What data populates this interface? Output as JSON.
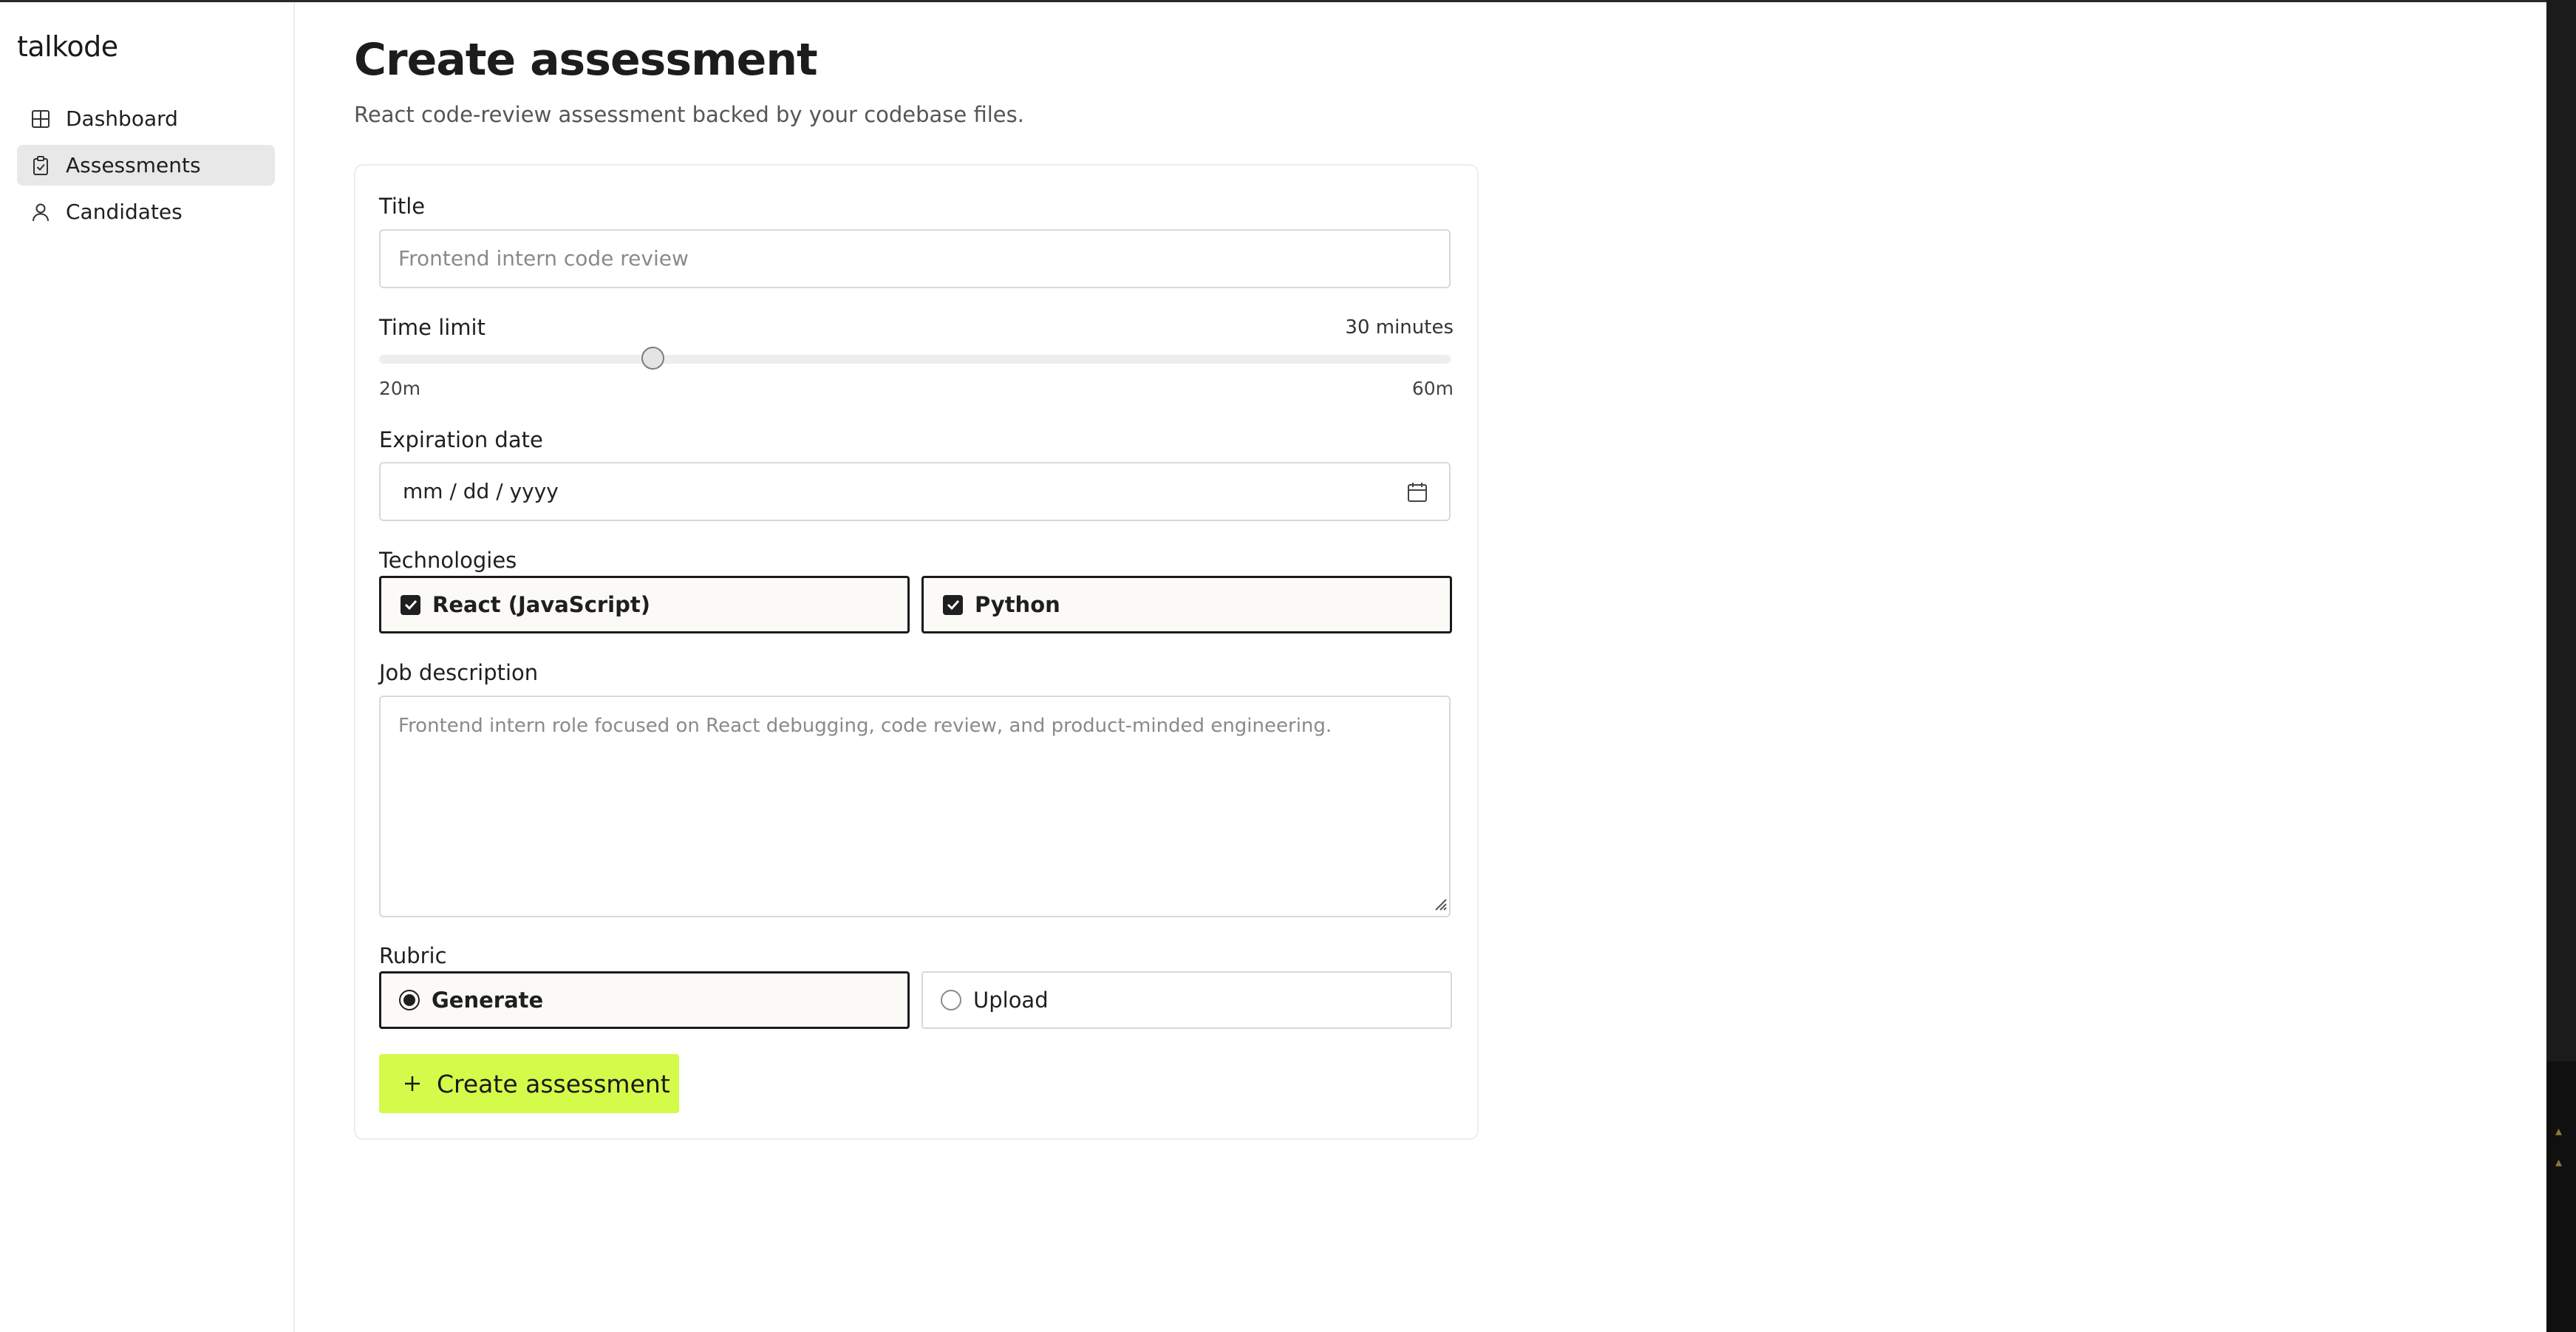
{
  "app": {
    "brand": "talkode"
  },
  "sidebar": {
    "items": [
      {
        "label": "Dashboard",
        "icon": "grid-icon",
        "active": false
      },
      {
        "label": "Assessments",
        "icon": "clipboard-check-icon",
        "active": true
      },
      {
        "label": "Candidates",
        "icon": "user-icon",
        "active": false
      }
    ]
  },
  "page": {
    "title": "Create assessment",
    "subtitle": "React code-review assessment backed by your codebase files."
  },
  "form": {
    "title_label": "Title",
    "title_placeholder": "Frontend intern code review",
    "time_limit": {
      "label": "Time limit",
      "value_text": "30 minutes",
      "min_label": "20m",
      "max_label": "60m",
      "min": 20,
      "max": 60,
      "value": 30
    },
    "expiration": {
      "label": "Expiration date",
      "placeholder": "mm / dd / yyyy",
      "icon": "calendar-icon"
    },
    "technologies": {
      "label": "Technologies",
      "options": [
        {
          "label": "React (JavaScript)",
          "checked": true
        },
        {
          "label": "Python",
          "checked": true
        }
      ]
    },
    "job_description": {
      "label": "Job description",
      "placeholder": "Frontend intern role focused on React debugging, code review, and product-minded engineering."
    },
    "rubric": {
      "label": "Rubric",
      "options": [
        {
          "label": "Generate",
          "selected": true
        },
        {
          "label": "Upload",
          "selected": false
        }
      ]
    },
    "submit_label": "Create assessment"
  },
  "colors": {
    "accent": "#d4fa4a",
    "active_nav": "#e8e8e8",
    "text": "#1f1f1f"
  }
}
